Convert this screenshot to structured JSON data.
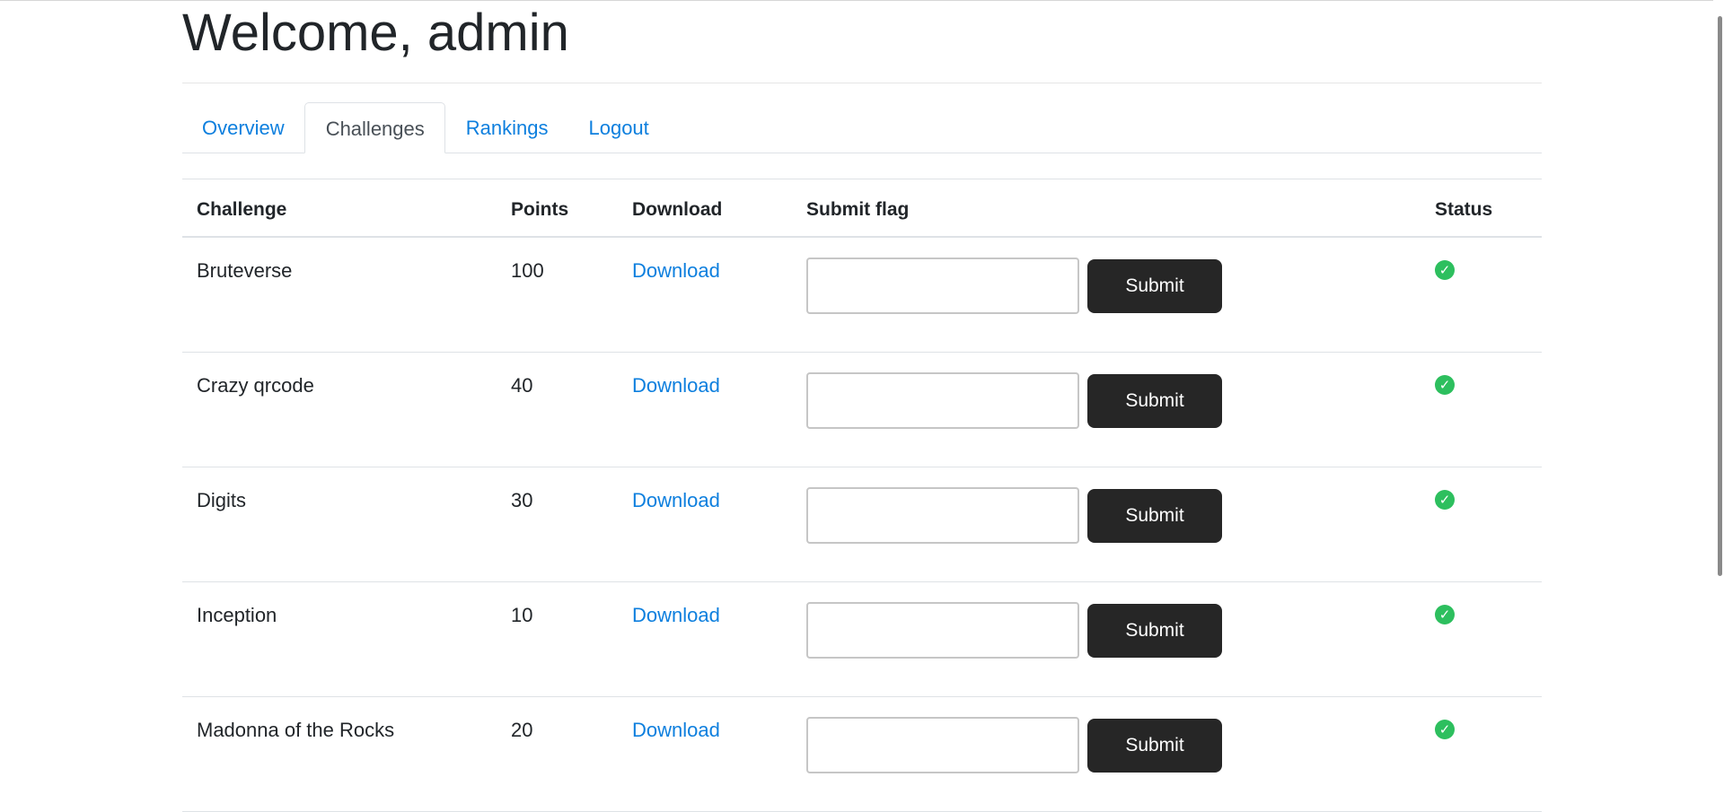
{
  "page": {
    "title": "Welcome, admin"
  },
  "tabs": [
    {
      "label": "Overview",
      "active": false
    },
    {
      "label": "Challenges",
      "active": true
    },
    {
      "label": "Rankings",
      "active": false
    },
    {
      "label": "Logout",
      "active": false
    }
  ],
  "table": {
    "headers": {
      "challenge": "Challenge",
      "points": "Points",
      "download": "Download",
      "submit_flag": "Submit flag",
      "status": "Status"
    },
    "rows": [
      {
        "name": "Bruteverse",
        "points": "100",
        "download_label": "Download",
        "flag_value": "",
        "submit_label": "Submit",
        "status_icon": "check-circle-icon"
      },
      {
        "name": "Crazy qrcode",
        "points": "40",
        "download_label": "Download",
        "flag_value": "",
        "submit_label": "Submit",
        "status_icon": "check-circle-icon"
      },
      {
        "name": "Digits",
        "points": "30",
        "download_label": "Download",
        "flag_value": "",
        "submit_label": "Submit",
        "status_icon": "check-circle-icon"
      },
      {
        "name": "Inception",
        "points": "10",
        "download_label": "Download",
        "flag_value": "",
        "submit_label": "Submit",
        "status_icon": "check-circle-icon"
      },
      {
        "name": "Madonna of the Rocks",
        "points": "20",
        "download_label": "Download",
        "flag_value": "",
        "submit_label": "Submit",
        "status_icon": "check-circle-icon"
      }
    ]
  },
  "colors": {
    "link": "#0d7fde",
    "button_bg": "#262626",
    "status_solved": "#2dbf5e"
  }
}
